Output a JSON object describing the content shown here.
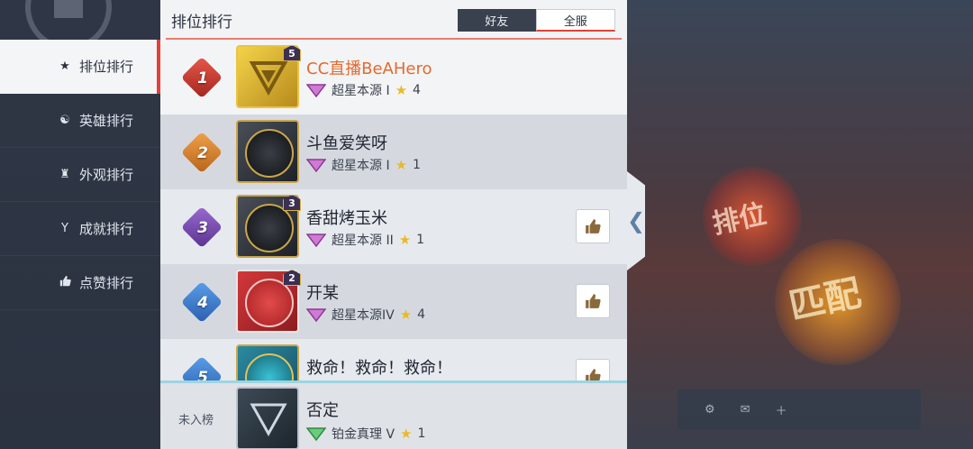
{
  "background": {
    "rank_word": "排位",
    "match_word": "匹配"
  },
  "sidebar": {
    "items": [
      {
        "label": "排位排行",
        "icon": "star-icon"
      },
      {
        "label": "英雄排行",
        "icon": "hero-icon"
      },
      {
        "label": "外观排行",
        "icon": "outfit-icon"
      },
      {
        "label": "成就排行",
        "icon": "trophy-icon"
      },
      {
        "label": "点赞排行",
        "icon": "thumbs-up-icon"
      }
    ]
  },
  "panel": {
    "title": "排位排行",
    "tabs": {
      "friends": "好友",
      "all": "全服"
    }
  },
  "rows": [
    {
      "rank": "1",
      "name": "CC直播BeAHero",
      "tier": "超星本源 I",
      "stars": "4",
      "avatar_star": "5"
    },
    {
      "rank": "2",
      "name": "斗鱼爱笑呀",
      "tier": "超星本源 I",
      "stars": "1",
      "avatar_star": ""
    },
    {
      "rank": "3",
      "name": "香甜烤玉米",
      "tier": "超星本源 II",
      "stars": "1",
      "avatar_star": "3"
    },
    {
      "rank": "4",
      "name": "开某",
      "tier": "超星本源IV",
      "stars": "4",
      "avatar_star": "2"
    },
    {
      "rank": "5",
      "name": "救命！救命！救命！",
      "tier": "",
      "stars": "",
      "avatar_star": ""
    }
  ],
  "self": {
    "unranked_label": "未入榜",
    "name": "否定",
    "tier": "铂金真理 V",
    "stars": "1"
  },
  "colors": {
    "accent_red": "#e3413a",
    "highlight_name": "#e36a2e",
    "star_gold": "#e9b92c"
  }
}
